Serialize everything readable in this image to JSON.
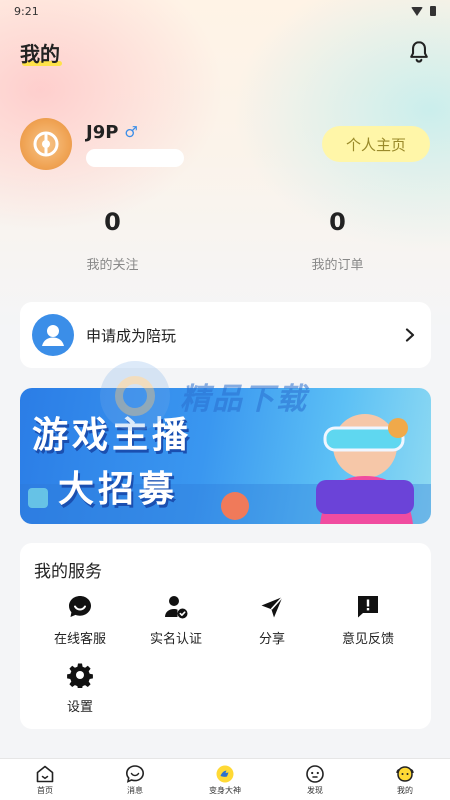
{
  "status": {
    "time": "9:21"
  },
  "header": {
    "title": "我的"
  },
  "profile": {
    "username": "J9P",
    "gender_symbol": "♂",
    "homepage_button": "个人主页"
  },
  "stats": [
    {
      "value": "0",
      "label": "我的关注"
    },
    {
      "value": "0",
      "label": "我的订单"
    }
  ],
  "apply": {
    "label": "申请成为陪玩"
  },
  "banner": {
    "line1": "游戏主播",
    "line2": "大招募",
    "watermark": "精品下载"
  },
  "services": {
    "title": "我的服务",
    "items": [
      {
        "label": "在线客服",
        "icon": "chat-icon"
      },
      {
        "label": "实名认证",
        "icon": "verified-user-icon"
      },
      {
        "label": "分享",
        "icon": "send-icon"
      },
      {
        "label": "意见反馈",
        "icon": "feedback-icon"
      },
      {
        "label": "设置",
        "icon": "gear-icon"
      }
    ]
  },
  "tabbar": [
    {
      "label": "首页",
      "icon": "home-icon"
    },
    {
      "label": "消息",
      "icon": "message-icon"
    },
    {
      "label": "变身大神",
      "icon": "transform-icon"
    },
    {
      "label": "发现",
      "icon": "discover-icon"
    },
    {
      "label": "我的",
      "icon": "profile-icon"
    }
  ],
  "colors": {
    "accent_yellow": "#ffe24a",
    "accent_blue": "#3b8ee8"
  }
}
